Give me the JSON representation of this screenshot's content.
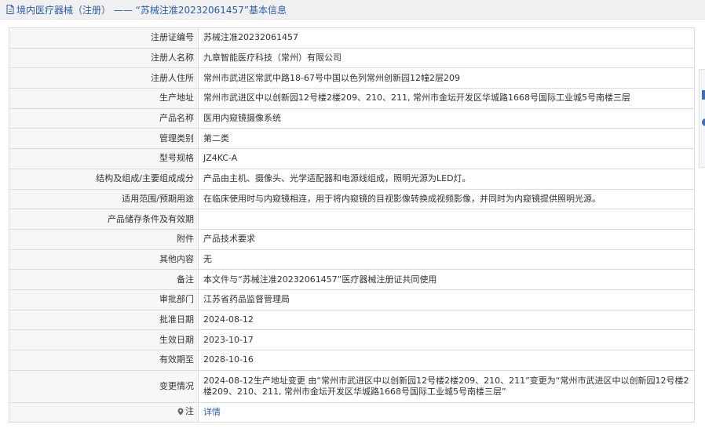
{
  "header": {
    "title": "境内医疗器械（注册） —— “苏械注准20232061457”基本信息"
  },
  "rows": [
    {
      "label": "注册证编号",
      "value": "苏械注准20232061457"
    },
    {
      "label": "注册人名称",
      "value": "九章智能医疗科技（常州）有限公司"
    },
    {
      "label": "注册人住所",
      "value": "常州市武进区常武中路18-67号中国以色列常州创新园12幢2层209"
    },
    {
      "label": "生产地址",
      "value": "常州市武进区中以创新园12号楼2楼209、210、211, 常州市金坛开发区华城路1668号国际工业城5号南楼三层"
    },
    {
      "label": "产品名称",
      "value": "医用内窥镜摄像系统"
    },
    {
      "label": "管理类别",
      "value": "第二类"
    },
    {
      "label": "型号规格",
      "value": "JZ4KC-A"
    },
    {
      "label": "结构及组成/主要组成成分",
      "value": "产品由主机、摄像头、光学适配器和电源线组成，照明光源为LED灯。"
    },
    {
      "label": "适用范围/预期用途",
      "value": "在临床使用时与内窥镜相连，用于将内窥镜的目视影像转换成视频影像，并同时为内窥镜提供照明光源。"
    },
    {
      "label": "产品储存条件及有效期",
      "value": ""
    },
    {
      "label": "附件",
      "value": "产品技术要求"
    },
    {
      "label": "其他内容",
      "value": "无"
    },
    {
      "label": "备注",
      "value": "本文件与“苏械注准20232061457”医疗器械注册证共同使用"
    },
    {
      "label": "审批部门",
      "value": "江苏省药品监督管理局"
    },
    {
      "label": "批准日期",
      "value": "2024-08-12"
    },
    {
      "label": "生效日期",
      "value": "2023-10-17"
    },
    {
      "label": "有效期至",
      "value": "2028-10-16"
    },
    {
      "label": "变更情况",
      "value": "2024-08-12生产地址变更 由“常州市武进区中以创新园12号楼2楼209、210、211”变更为“常州市武进区中以创新园12号楼2楼209、210、211, 常州市金坛开发区华城路1668号国际工业城5号南楼三层”"
    }
  ],
  "note": {
    "label": "注",
    "icon": "location-pin-icon",
    "link": "详情"
  },
  "colors": {
    "link": "#2a5fa8",
    "label_bg": "#f7f7f7",
    "border": "#dcdcdc",
    "header_bg": "#f0f0f0"
  }
}
